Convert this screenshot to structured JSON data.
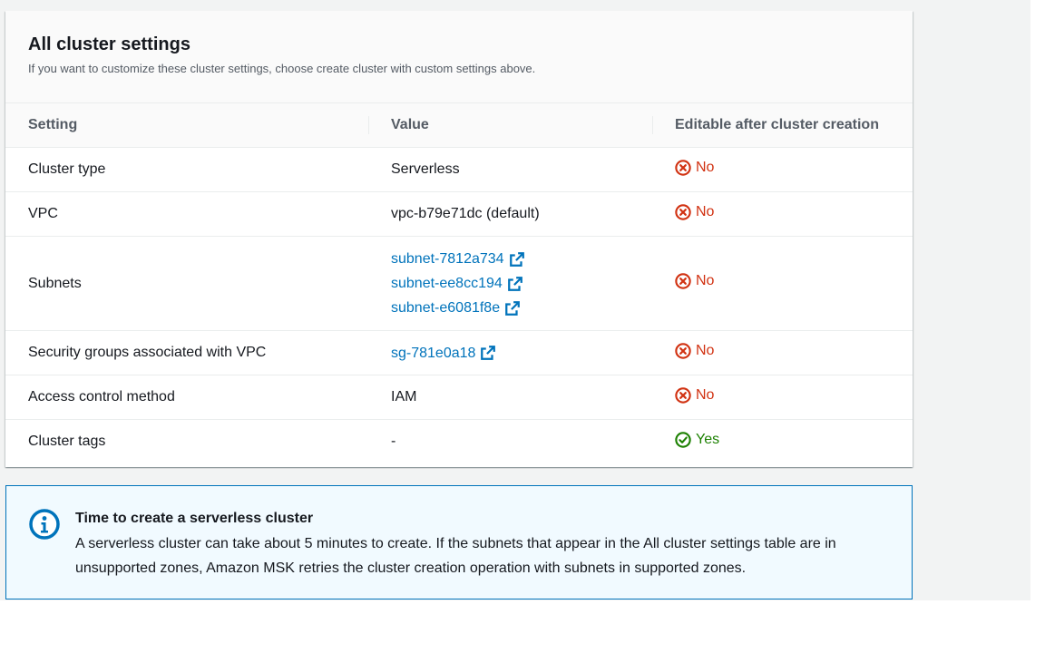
{
  "panel": {
    "title": "All cluster settings",
    "description": "If you want to customize these cluster settings, choose create cluster with custom settings above."
  },
  "table": {
    "headers": [
      "Setting",
      "Value",
      "Editable after cluster creation"
    ],
    "rows": [
      {
        "setting": "Cluster type",
        "value": "Serverless",
        "editable": "No"
      },
      {
        "setting": "VPC",
        "value": "vpc-b79e71dc (default)",
        "editable": "No"
      },
      {
        "setting": "Subnets",
        "links": [
          "subnet-7812a734",
          "subnet-ee8cc194",
          "subnet-e6081f8e"
        ],
        "editable": "No"
      },
      {
        "setting": "Security groups associated with VPC",
        "links": [
          "sg-781e0a18"
        ],
        "editable": "No"
      },
      {
        "setting": "Access control method",
        "value": "IAM",
        "editable": "No"
      },
      {
        "setting": "Cluster tags",
        "value": "-",
        "editable": "Yes"
      }
    ]
  },
  "info": {
    "title": "Time to create a serverless cluster",
    "body": "A serverless cluster can take about 5 minutes to create. If the subnets that appear in the All cluster settings table are in unsupported zones, Amazon MSK retries the cluster creation operation with subnets in supported zones."
  },
  "colors": {
    "link": "#0073bb",
    "no": "#d13212",
    "yes": "#1d8102",
    "info_border": "#0073bb",
    "info_bg": "#f1faff"
  },
  "icons": {
    "no": "x-circle-icon",
    "yes": "check-circle-icon",
    "external": "external-link-icon",
    "info": "info-icon"
  }
}
